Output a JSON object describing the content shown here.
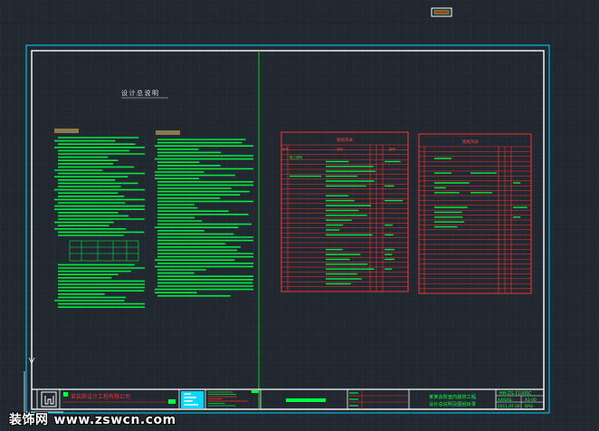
{
  "drawing": {
    "notes_title": "设计总说明",
    "table_left": {
      "title": "图纸目录",
      "col1": "序号",
      "col2": "名称",
      "col3": "图号",
      "row1": "施工说明"
    },
    "table_right": {
      "title": "图纸目录"
    },
    "titleblock": {
      "company": "某装饰设计工程有限公司",
      "project_line1": "某某会所室内装饰工程",
      "project_line2": "设计总说明及图纸目录",
      "drawing_no": "HH-ZS-1100SC",
      "scale": "A4ISAS",
      "sheet": "A1-00",
      "date": "2011.07.08",
      "version": "DA0"
    }
  },
  "watermark": {
    "brand": "装饰网",
    "url": "www.zswcn.com"
  },
  "colors": {
    "background": "#212830",
    "frame": "#00d8ff",
    "border": "#ffffff",
    "text": "#00ff40",
    "table": "#ff3030",
    "grid": "#2a323b",
    "cursor": "#00ff00"
  }
}
